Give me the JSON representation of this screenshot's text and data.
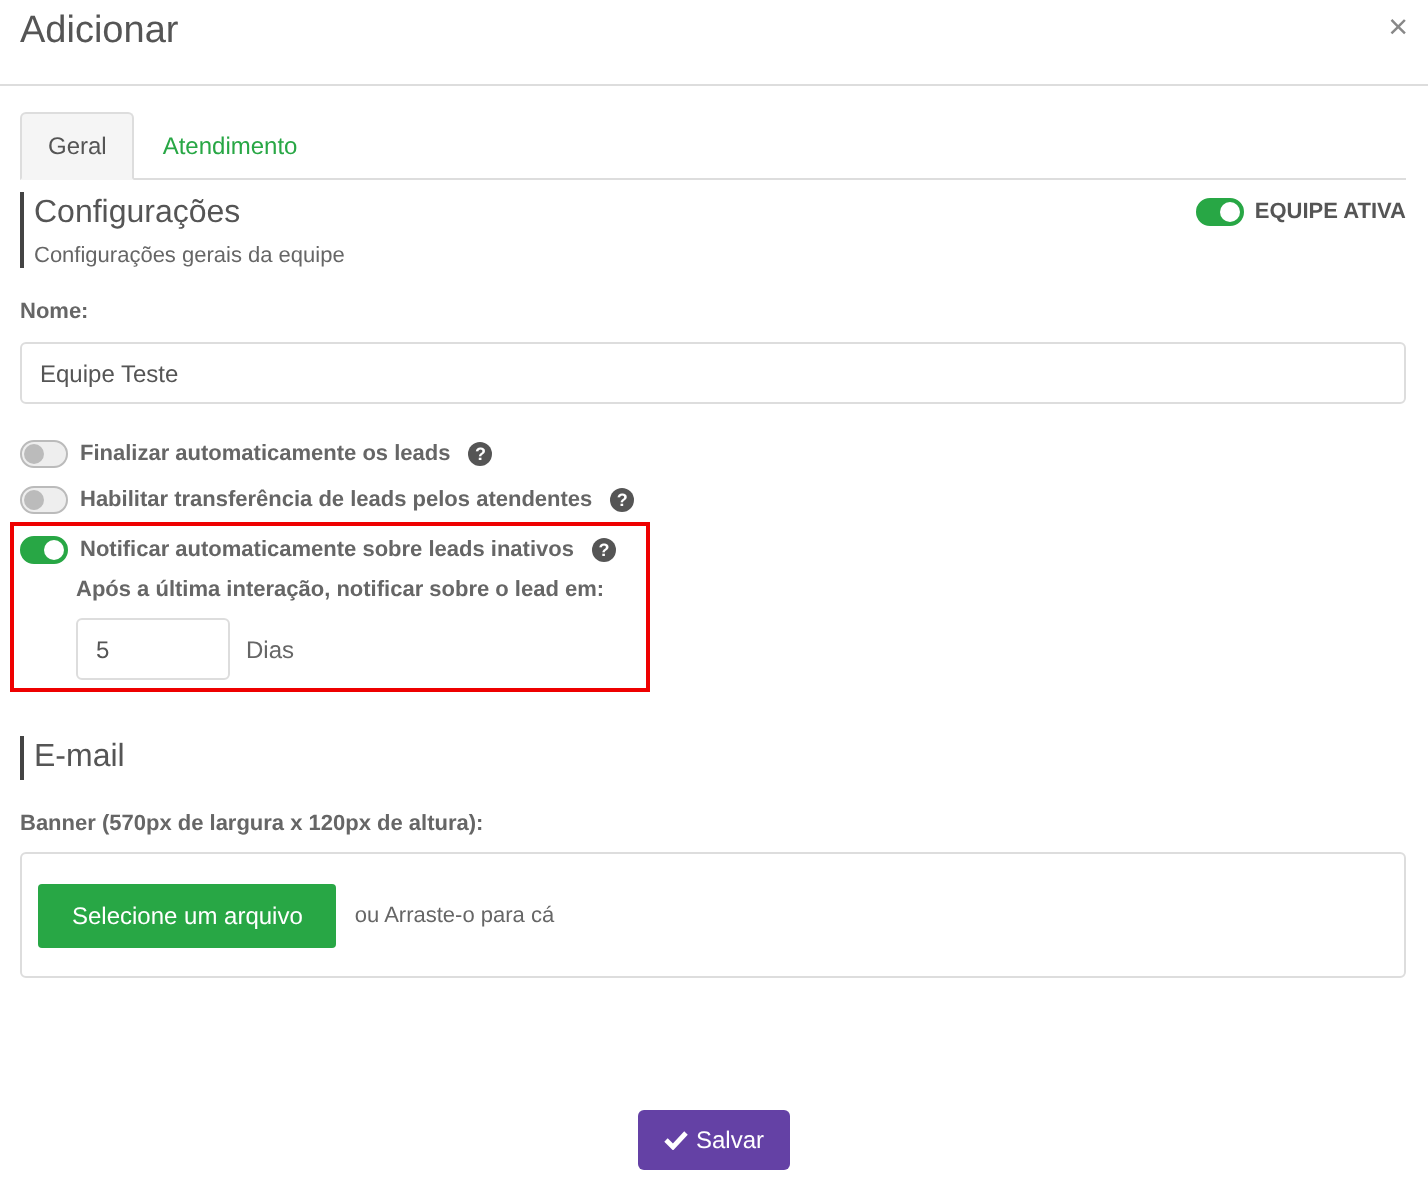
{
  "window": {
    "title": "Adicionar",
    "close": "×"
  },
  "tabs": [
    {
      "label": "Geral",
      "selected": true
    },
    {
      "label": "Atendimento",
      "selected": false
    }
  ],
  "section": {
    "title": "Configurações",
    "subtitle": "Configurações gerais da equipe",
    "active_toggle": {
      "label": "EQUIPE ATIVA",
      "on": true
    }
  },
  "name_field": {
    "label": "Nome:",
    "value": "Equipe Teste"
  },
  "options": [
    {
      "label": "Finalizar automaticamente os leads",
      "on": false,
      "help": "?",
      "highlighted": false
    },
    {
      "label": "Habilitar transferência de leads pelos atendentes",
      "on": false,
      "help": "?",
      "highlighted": false
    },
    {
      "label": "Notificar automaticamente sobre leads inativos",
      "on": true,
      "help": "?",
      "highlighted": true,
      "detail": {
        "label": "Após a última interação, notificar sobre o lead em:",
        "value": "5",
        "unit": "Dias"
      }
    }
  ],
  "email": {
    "title": "E-mail",
    "banner_label": "Banner (570px de largura x 120px de altura):",
    "select_button": "Selecione um arquivo",
    "drop_hint": "ou Arraste-o para cá"
  },
  "save_button": "Salvar"
}
